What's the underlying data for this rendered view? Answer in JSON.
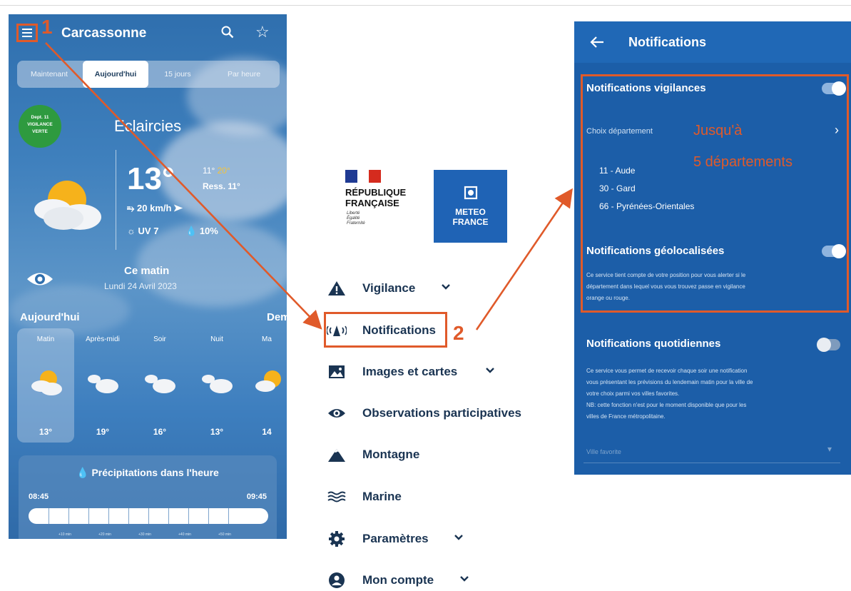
{
  "steps": {
    "one": "1",
    "two": "2"
  },
  "phone": {
    "city": "Carcassonne",
    "tabs": [
      "Maintenant",
      "Aujourd'hui",
      "15 jours",
      "Par heure"
    ],
    "vigilance_badge": {
      "line1": "Dept. 11",
      "line2": "VIGILANCE",
      "line3": "VERTE",
      "color": "#2e9a3f"
    },
    "weather_desc": "Eclaircies",
    "temp": "13°",
    "min": "11°",
    "max": "20°",
    "ress": "Ress. 11°",
    "wind": "20 km/h",
    "uv": "UV 7",
    "rain_pct": "10%",
    "period_title": "Ce matin",
    "date": "Lundi 24 Avril 2023",
    "today_label": "Aujourd'hui",
    "next_label": "Dem",
    "forecast": [
      {
        "label": "Matin",
        "temp": "13°",
        "icon": "sun-cloud-icon"
      },
      {
        "label": "Après-midi",
        "temp": "19°",
        "icon": "cloud-icon"
      },
      {
        "label": "Soir",
        "temp": "16°",
        "icon": "cloud-icon"
      },
      {
        "label": "Nuit",
        "temp": "13°",
        "icon": "cloud-icon"
      },
      {
        "label": "Ma",
        "temp": "14",
        "icon": "sun-cloud-icon"
      }
    ],
    "precip": {
      "title": "Précipitations dans l'heure",
      "start": "08:45",
      "end": "09:45",
      "ticks": [
        "+10 min",
        "+20 min",
        "+30 min",
        "+40 min",
        "+50 min"
      ]
    }
  },
  "logos": {
    "republique_line1": "RÉPUBLIQUE",
    "republique_line2": "FRANÇAISE",
    "motto1": "Liberté",
    "motto2": "Égalité",
    "motto3": "Fraternité",
    "meteo_line1": "METEO",
    "meteo_line2": "FRANCE",
    "meteo_blue": "#1f63b5"
  },
  "menu": [
    {
      "label": "Vigilance",
      "icon": "warning-icon"
    },
    {
      "label": "Notifications",
      "icon": "notification-wave-icon"
    },
    {
      "label": "Images et cartes",
      "icon": "image-icon"
    },
    {
      "label": "Observations participatives",
      "icon": "eye-icon"
    },
    {
      "label": "Montagne",
      "icon": "mountain-icon"
    },
    {
      "label": "Marine",
      "icon": "waves-icon"
    },
    {
      "label": "Paramètres",
      "icon": "gear-icon"
    },
    {
      "label": "Mon compte",
      "icon": "user-icon"
    }
  ],
  "notifications": {
    "title": "Notifications",
    "vigilance_title": "Notifications vigilances",
    "vigilance_on": true,
    "choice_label": "Choix département",
    "annotation_line1": "Jusqu'à",
    "annotation_line2": "5 départements",
    "departments": [
      "11 - Aude",
      "30 - Gard",
      "66 - Pyrénées-Orientales"
    ],
    "geo_title": "Notifications géolocalisées",
    "geo_on": true,
    "geo_desc_1": "Ce service tient compte de votre position pour vous alerter si le",
    "geo_desc_2": "département dans lequel vous vous trouvez passe en vigilance",
    "geo_desc_3": "orange ou rouge.",
    "daily_title": "Notifications quotidiennes",
    "daily_on": false,
    "daily_desc_1": "Ce service vous permet de recevoir chaque soir une notification",
    "daily_desc_2": "vous présentant les prévisions du lendemain matin pour la ville de",
    "daily_desc_3": "votre choix parmi vos villes favorites.",
    "daily_desc_4": "NB: cette fonction n'est pour le moment disponible que pour les",
    "daily_desc_5": "villes de France métropolitaine.",
    "fav_placeholder": "Ville favorite"
  },
  "colors": {
    "annotation": "#e05a2a",
    "panel": "#1c5ea8",
    "text_dark": "#1a3452"
  }
}
